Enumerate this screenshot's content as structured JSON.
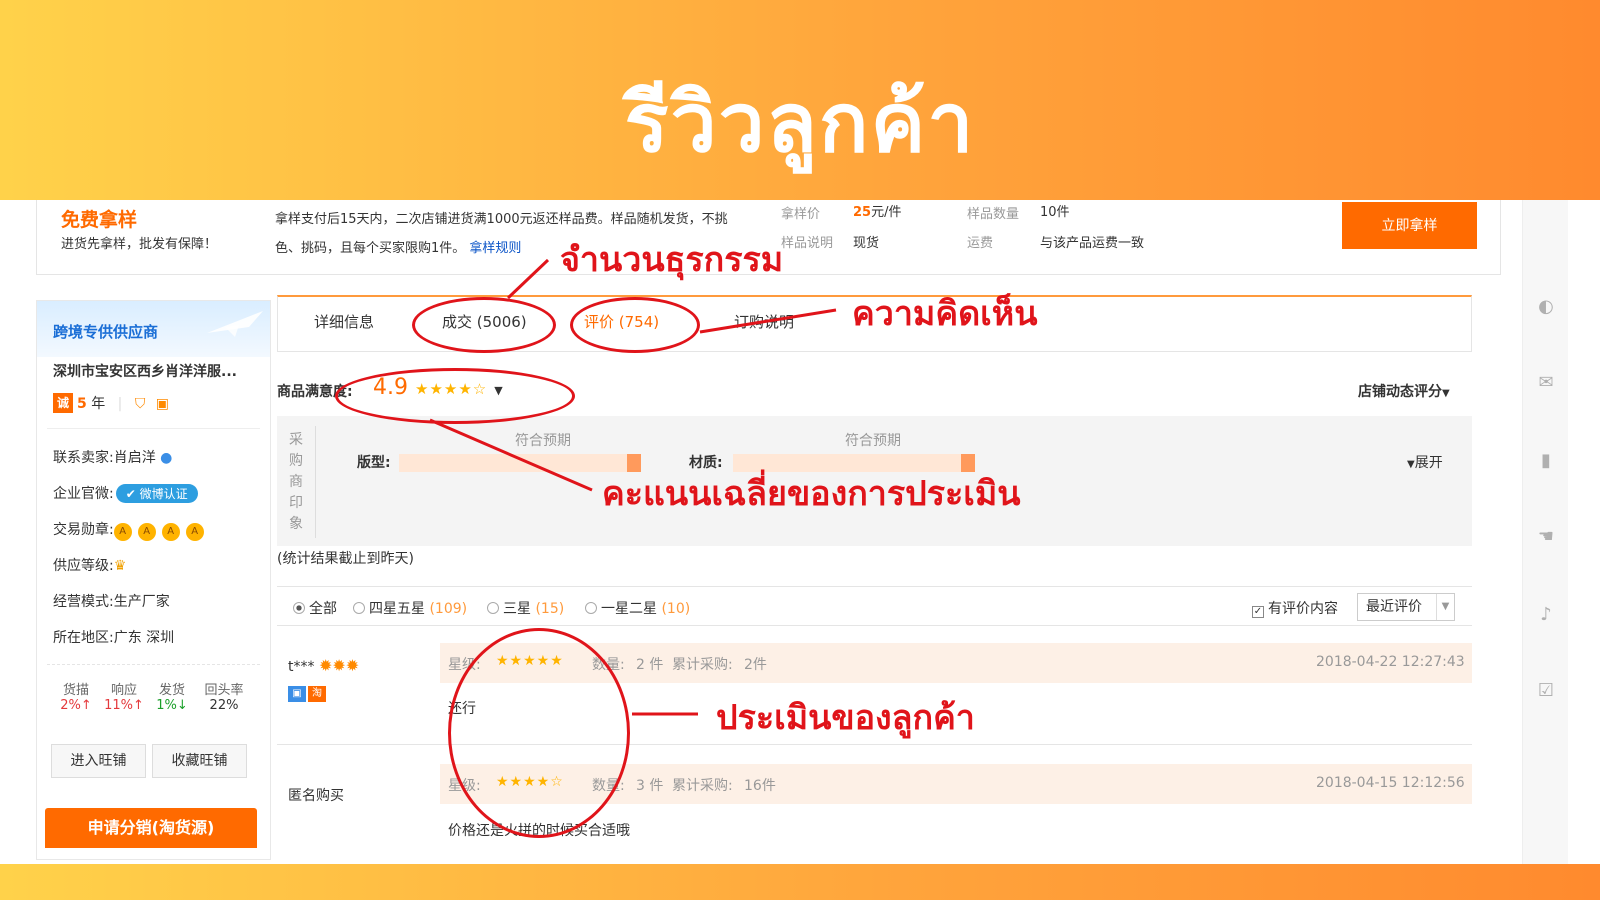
{
  "banner": {
    "title": "รีวิวลูกค้า"
  },
  "sample": {
    "title": "免费拿样",
    "subtitle": "进货先拿样，批发有保障！",
    "desc": "拿样支付后15天内，二次店铺进货满1000元返还样品费。样品随机发货，不挑色、挑码，且每个买家限购1件。",
    "rule_link": "拿样规则",
    "price_label": "拿样价",
    "price_value": "25",
    "price_unit": "元/件",
    "qty_label": "样品数量",
    "qty_value": "10件",
    "desc_label": "样品说明",
    "desc_value": "现货",
    "freight_label": "运费",
    "freight_value": "与该产品运费一致",
    "apply_button": "立即拿样"
  },
  "sidebar": {
    "cross_border": "跨境专供供应商",
    "shop_name": "深圳市宝安区西乡肖洋洋服...",
    "cheng_badge": "诚",
    "years_num": "5",
    "years_unit": "年",
    "contact_label": "联系卖家:",
    "contact_value": "肖启洋",
    "official_label": "企业官微:",
    "weibo_badge": "微博认证",
    "medal_label": "交易勋章:",
    "supply_label": "供应等级:",
    "mode_label": "经营模式:",
    "mode_value": "生产厂家",
    "region_label": "所在地区:",
    "region_value": "广东 深圳",
    "stats": [
      {
        "label": "货描",
        "value": "2%↑",
        "trend": "up"
      },
      {
        "label": "响应",
        "value": "11%↑",
        "trend": "up"
      },
      {
        "label": "发货",
        "value": "1%↓",
        "trend": "down"
      },
      {
        "label": "回头率",
        "value": "22%",
        "trend": "none"
      }
    ],
    "enter_shop": "进入旺铺",
    "fav_shop": "收藏旺铺",
    "distribute_button": "申请分销(淘货源)"
  },
  "tabs": {
    "detail": "详细信息",
    "deals": "成交 (5006)",
    "reviews": "评价 (754)",
    "order_note": "订购说明"
  },
  "rating": {
    "satisfaction_label": "商品满意度:",
    "score": "4.9",
    "stars": "★★★★☆",
    "shop_dynamic": "店铺动态评分"
  },
  "impression": {
    "vertical_label": "采购商印象",
    "items": [
      {
        "label": "版型:",
        "tag": "符合预期",
        "fraction": 0.95
      },
      {
        "label": "材质:",
        "tag": "符合预期",
        "fraction": 0.95
      }
    ],
    "expand": "展开"
  },
  "stat_note": "(统计结果截止到昨天)",
  "filters": {
    "all": "全部",
    "four_five": "四星五星",
    "four_five_count": "(109)",
    "three": "三星",
    "three_count": "(15)",
    "one_two": "一星二星",
    "one_two_count": "(10)",
    "has_content": "有评价内容",
    "sort": "最近评价"
  },
  "reviews": [
    {
      "buyer": "t***",
      "star_label": "星级:",
      "stars": "★★★★★",
      "qty_label": "数量:",
      "qty": "2 件",
      "total_label": "累计采购:",
      "total": "2件",
      "date": "2018-04-22 12:27:43",
      "text": "还行"
    },
    {
      "buyer": "匿名购买",
      "star_label": "星级:",
      "stars": "★★★★☆",
      "qty_label": "数量:",
      "qty": "3 件",
      "total_label": "累计采购:",
      "total": "16件",
      "date": "2018-04-15 12:12:56",
      "text": "价格还是火拼的时候买合适哦"
    }
  ],
  "annotations": {
    "transactions": "จำนวนธุรกรรม",
    "comments": "ความคิดเห็น",
    "avg_score": "คะแนนเฉลี่ยของการประเมิน",
    "customer_review": "ประเมินของลูกค้า"
  },
  "colors": {
    "accent": "#ff6a00",
    "annotation": "#e0141a",
    "banner_start": "#ffd24a",
    "banner_end": "#ff8a2e"
  }
}
